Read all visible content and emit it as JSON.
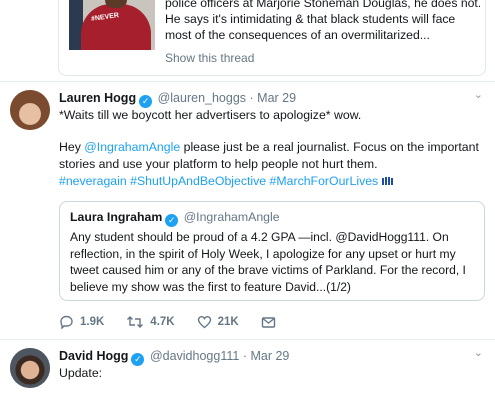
{
  "top_quote": {
    "text": "police officers at Marjorie Stoneman Douglas, he does not. He says it's intimidating & that black students will face most of the consequences of an overmilitarized...",
    "show_thread": "Show this thread",
    "shirt_text": "#NEVER"
  },
  "tweet_lauren": {
    "name": "Lauren Hogg",
    "handle": "@lauren_hoggs",
    "date": "Mar 29",
    "line1": "*Waits till we boycott her advertisers to apologize* wow.",
    "hey": "Hey",
    "mention": "@IngrahamAngle",
    "line2_rest": " please just be a real journalist. Focus on the important stories and use your platform to help people not hurt them.",
    "hashtags": "#neveragain #ShutUpAndBeObjective #MarchForOurLives",
    "quote": {
      "name": "Laura Ingraham",
      "handle": "@IngrahamAngle",
      "text": "Any student should be proud of a 4.2 GPA —incl. @DavidHogg111.  On reflection, in the spirit of Holy Week, I apologize for any upset or hurt my tweet caused him or any of the brave victims of Parkland. For the record, I believe my show was the first to feature David...(1/2)"
    },
    "actions": {
      "replies": "1.9K",
      "retweets": "4.7K",
      "likes": "21K"
    }
  },
  "tweet_david": {
    "name": "David Hogg",
    "handle": "@davidhogg111",
    "date": "Mar 29",
    "text": "Update:"
  },
  "colors": {
    "accent": "#1da1f2",
    "muted": "#657786",
    "border": "#e6ecf0"
  }
}
